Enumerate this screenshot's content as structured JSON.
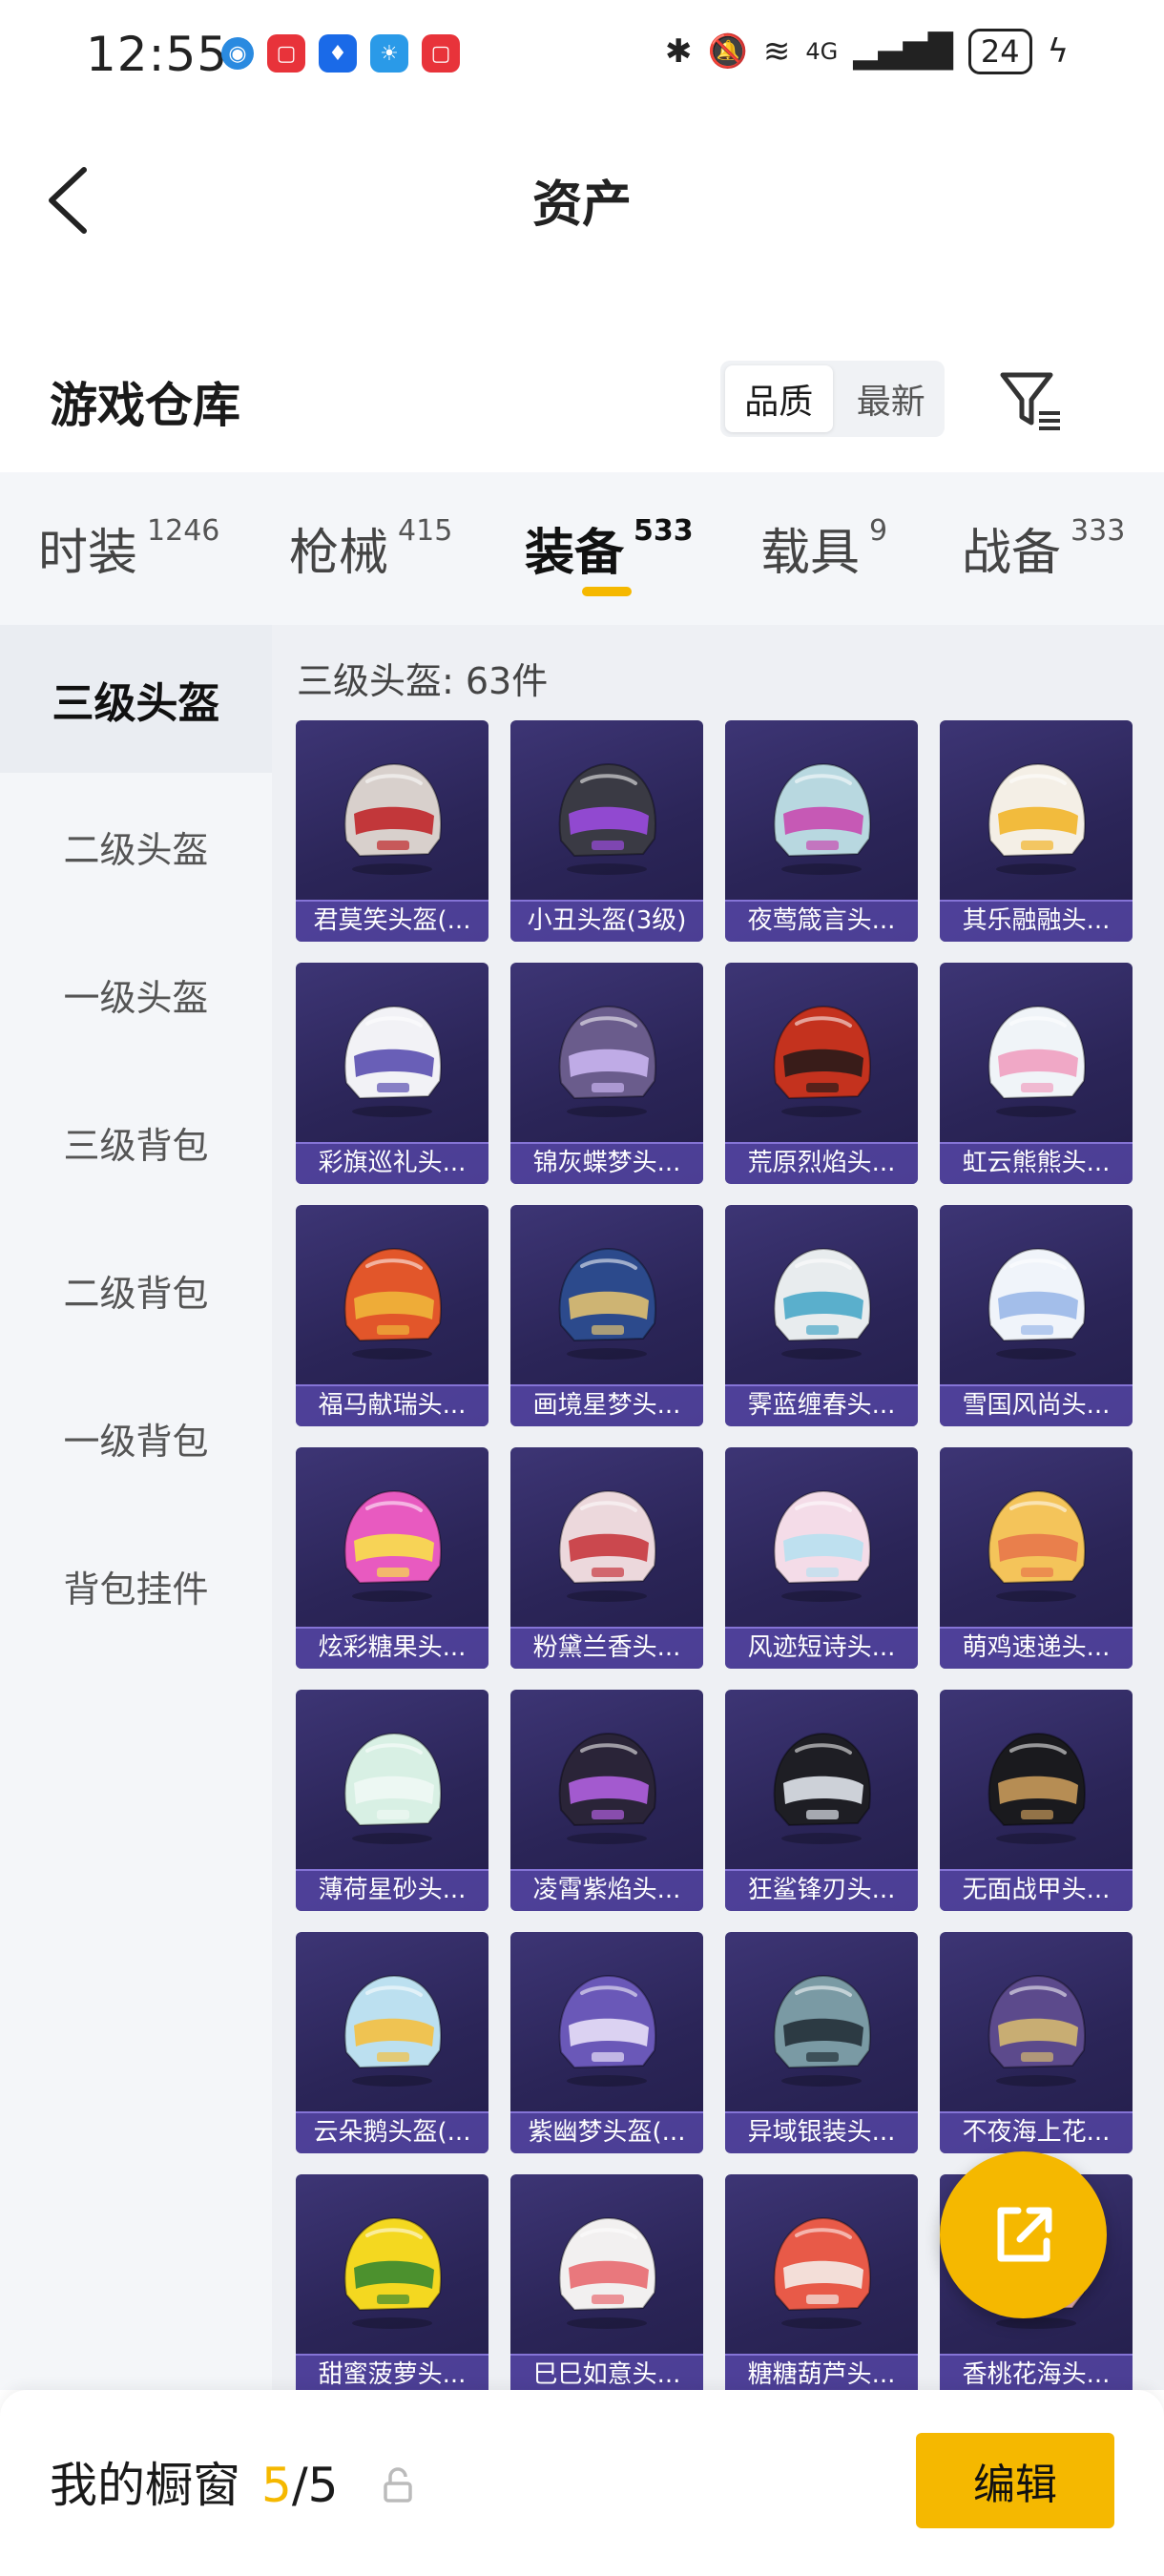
{
  "status_bar": {
    "time": "12:55",
    "network": "4G",
    "battery": "24"
  },
  "header": {
    "title": "资产"
  },
  "warehouse": {
    "title": "游戏仓库",
    "sort": {
      "quality": "品质",
      "latest": "最新"
    }
  },
  "tabs": [
    {
      "label": "时装",
      "count": "1246"
    },
    {
      "label": "枪械",
      "count": "415"
    },
    {
      "label": "装备",
      "count": "533"
    },
    {
      "label": "载具",
      "count": "9"
    },
    {
      "label": "战备",
      "count": "333"
    }
  ],
  "sidebar": {
    "items": [
      {
        "label": "三级头盔"
      },
      {
        "label": "二级头盔"
      },
      {
        "label": "一级头盔"
      },
      {
        "label": "三级背包"
      },
      {
        "label": "二级背包"
      },
      {
        "label": "一级背包"
      },
      {
        "label": "背包挂件"
      }
    ]
  },
  "content": {
    "count_label": "三级头盔: 63件",
    "items": [
      {
        "name": "君莫笑头盔(...",
        "color": "#d8d0cc",
        "accent": "#c0262a"
      },
      {
        "name": "小丑头盔(3级)",
        "color": "#3a3a44",
        "accent": "#9b4be0"
      },
      {
        "name": "夜莺箴言头...",
        "color": "#b8d8e0",
        "accent": "#c84bb0"
      },
      {
        "name": "其乐融融头...",
        "color": "#f4efe6",
        "accent": "#f2b52a"
      },
      {
        "name": "彩旗巡礼头...",
        "color": "#f2f2f6",
        "accent": "#5a4fb0"
      },
      {
        "name": "锦灰蝶梦头...",
        "color": "#6a5c8c",
        "accent": "#c9b4f0"
      },
      {
        "name": "荒原烈焰头...",
        "color": "#c4321e",
        "accent": "#2a1a18"
      },
      {
        "name": "虹云熊熊头...",
        "color": "#f0f4f8",
        "accent": "#f0a0c0"
      },
      {
        "name": "福马献瑞头...",
        "color": "#e2562a",
        "accent": "#f0b63a"
      },
      {
        "name": "画境星梦头...",
        "color": "#2c4a8c",
        "accent": "#e0c070"
      },
      {
        "name": "霁蓝缠春头...",
        "color": "#e8ecee",
        "accent": "#4aa8c8"
      },
      {
        "name": "雪国风尚头...",
        "color": "#f0f4fa",
        "accent": "#9ab8e8"
      },
      {
        "name": "炫彩糖果头...",
        "color": "#e85ac0",
        "accent": "#f8e04a"
      },
      {
        "name": "粉黛兰香头...",
        "color": "#ecd8dc",
        "accent": "#c8383e"
      },
      {
        "name": "风迹短诗头...",
        "color": "#f4dce8",
        "accent": "#b8e0f0"
      },
      {
        "name": "萌鸡速递头...",
        "color": "#f4c45a",
        "accent": "#e8784a"
      },
      {
        "name": "薄荷星砂头...",
        "color": "#d8f0e4",
        "accent": "#f0f8f4"
      },
      {
        "name": "凌霄紫焰头...",
        "color": "#2a2438",
        "accent": "#b060e0"
      },
      {
        "name": "狂鲨锋刃头...",
        "color": "#1e1e24",
        "accent": "#e0e4ec"
      },
      {
        "name": "无面战甲头...",
        "color": "#1a1a1e",
        "accent": "#c89a5a"
      },
      {
        "name": "云朵鹅头盔(...",
        "color": "#bce0f0",
        "accent": "#f4c040"
      },
      {
        "name": "紫幽梦头盔(...",
        "color": "#6a58b8",
        "accent": "#e8e0f8"
      },
      {
        "name": "异域银装头...",
        "color": "#7a9aa4",
        "accent": "#243038"
      },
      {
        "name": "不夜海上花...",
        "color": "#5c4a8c",
        "accent": "#d4b870"
      },
      {
        "name": "甜蜜菠萝头...",
        "color": "#f4d820",
        "accent": "#3a8a30"
      },
      {
        "name": "巳巳如意头...",
        "color": "#f2f0f0",
        "accent": "#e86a70"
      },
      {
        "name": "糖糖葫芦头...",
        "color": "#e85a48",
        "accent": "#f4ece8"
      },
      {
        "name": "香桃花海头...",
        "color": "#f4b8c0",
        "accent": "#e86a80"
      }
    ]
  },
  "bottom": {
    "label": "我的橱窗",
    "count_current": "5",
    "count_sep": "/",
    "count_total": "5",
    "edit": "编辑"
  },
  "colors": {
    "accent": "#f5b800",
    "card_bg": "#2b2558",
    "card_stripe": "#6e5ad2"
  }
}
